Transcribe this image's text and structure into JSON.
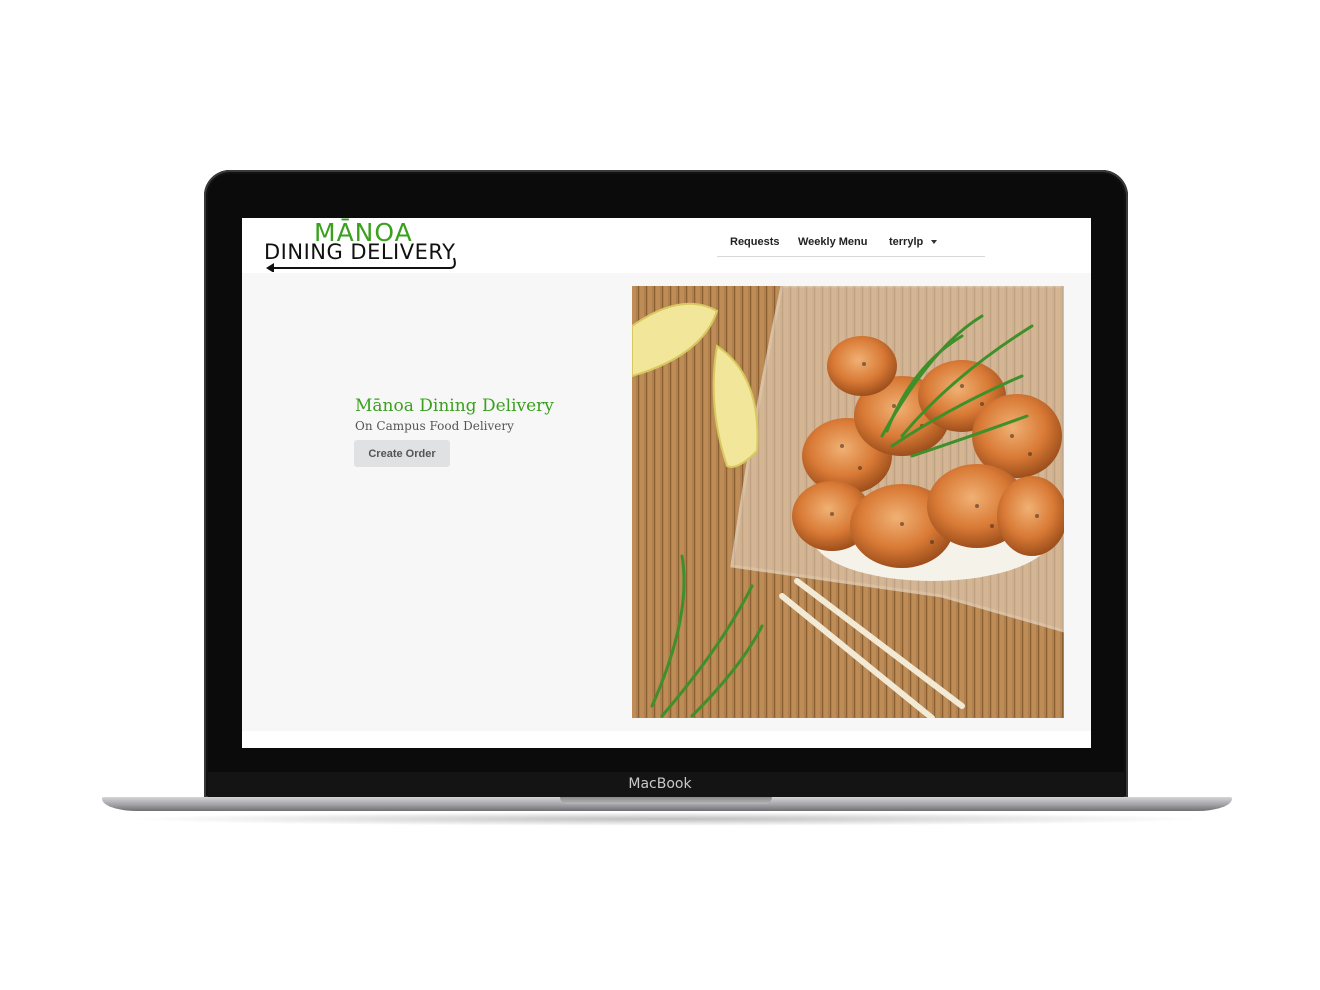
{
  "device": {
    "brand_label": "MacBook"
  },
  "navbar": {
    "logo_top": "MĀNOA",
    "logo_bottom": "DINING DELIVERY",
    "items": [
      {
        "label": "Requests"
      },
      {
        "label": "Weekly Menu"
      }
    ],
    "user_menu": {
      "label": "terrylp"
    }
  },
  "hero": {
    "title": "Mānoa Dining Delivery",
    "subtitle": "On Campus Food Delivery",
    "button_label": "Create Order"
  },
  "colors": {
    "accent_green": "#3aa01e",
    "content_background": "#f7f7f7",
    "button_background": "#e0e1e2"
  }
}
